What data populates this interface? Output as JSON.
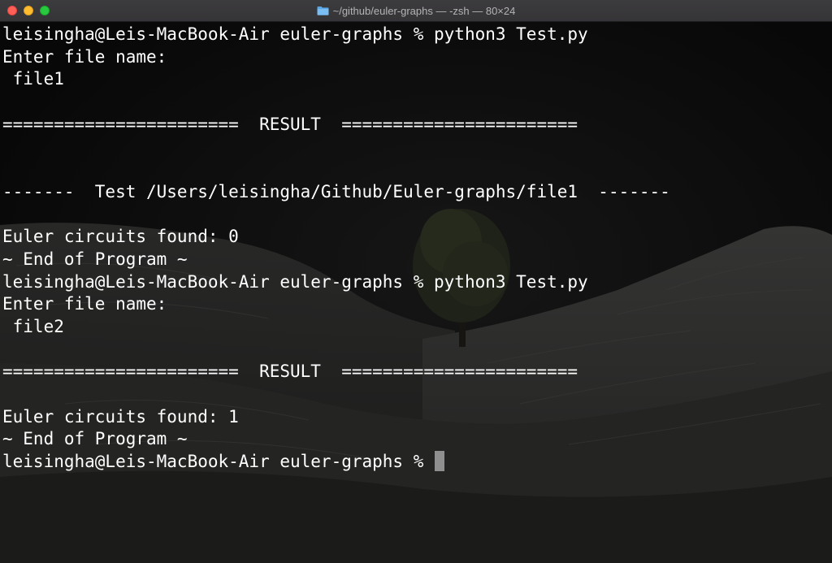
{
  "window": {
    "title": "~/github/euler-graphs — -zsh — 80×24",
    "folder_icon": "folder-icon",
    "controls": [
      "close-button",
      "minimize-button",
      "zoom-button"
    ]
  },
  "terminal": {
    "lines": [
      "leisingha@Leis-MacBook-Air euler-graphs % python3 Test.py",
      "Enter file name:",
      " file1",
      "",
      "=======================  RESULT  =======================",
      "",
      "",
      "-------  Test /Users/leisingha/Github/Euler-graphs/file1  -------",
      "",
      "Euler circuits found: 0",
      "~ End of Program ~",
      "leisingha@Leis-MacBook-Air euler-graphs % python3 Test.py",
      "Enter file name:",
      " file2",
      "",
      "=======================  RESULT  =======================",
      "",
      "Euler circuits found: 1",
      "~ End of Program ~"
    ],
    "prompt": "leisingha@Leis-MacBook-Air euler-graphs % ",
    "text_color": "#ffffff",
    "cursor_color": "#8f8f8f"
  }
}
